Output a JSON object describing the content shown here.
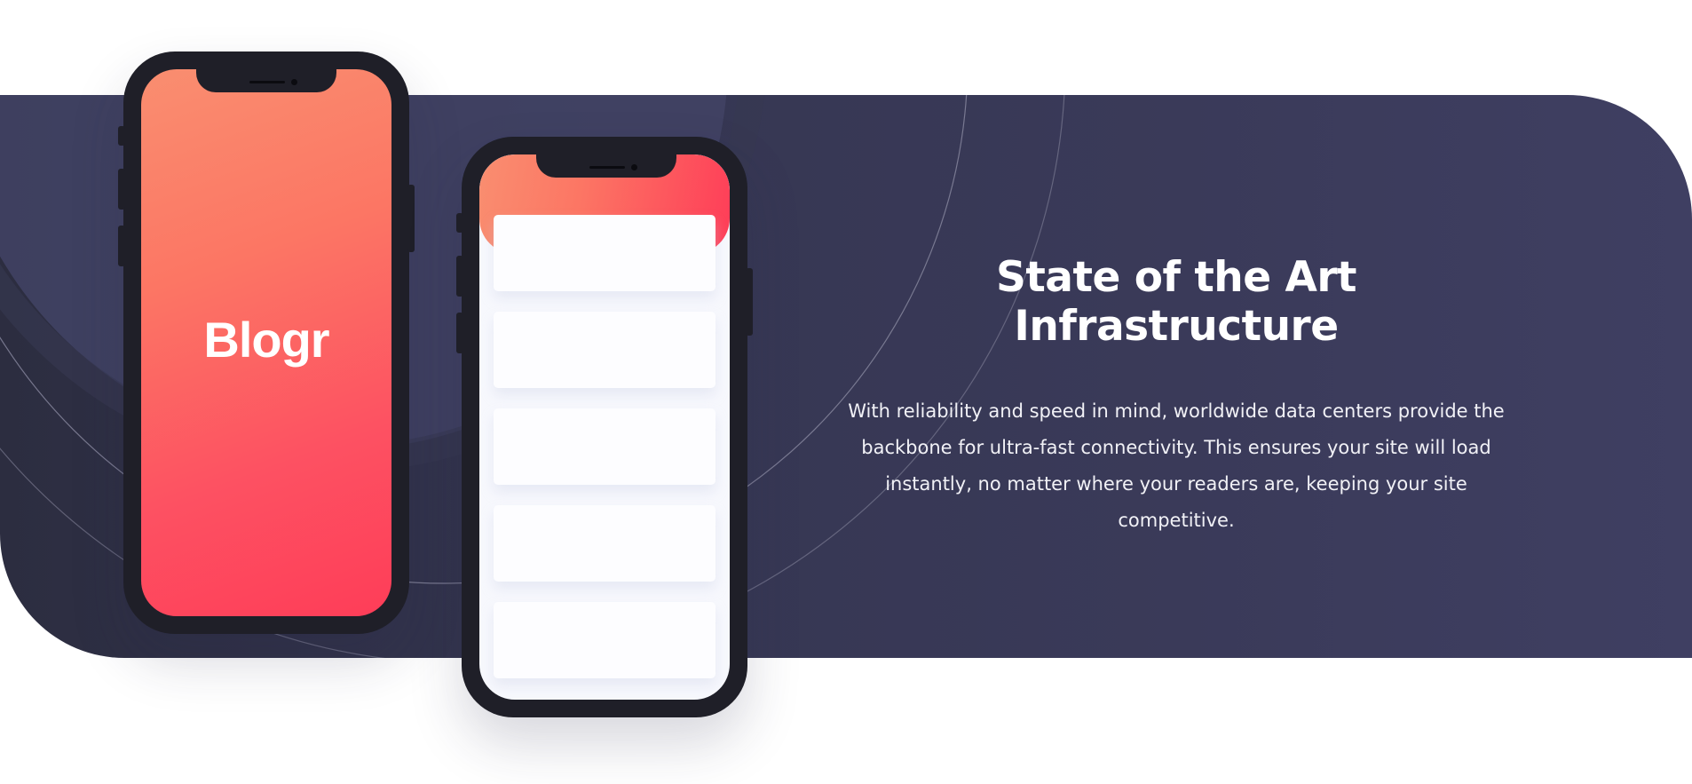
{
  "section": {
    "title": "State of the Art Infrastructure",
    "description": "With reliability and speed in mind, worldwide data centers provide the backbone for ultra-fast connectivity. This ensures your site will load instantly, no matter where your readers are, keeping your site competitive."
  },
  "phone_brand": "Blogr",
  "colors": {
    "band_dark": "#2c2d40",
    "band_light": "#3f3f62",
    "gradient_start": "#f98e70",
    "gradient_end": "#fe3d58",
    "phone_frame": "#1f1f28",
    "text": "#ffffff"
  },
  "cards_count": 5
}
